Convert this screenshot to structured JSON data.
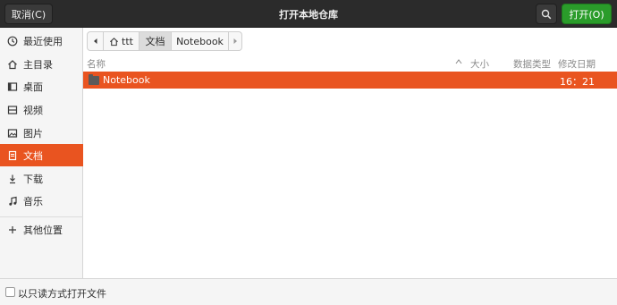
{
  "header": {
    "cancel_label": "取消(C)",
    "title": "打开本地仓库",
    "open_label": "打开(O)"
  },
  "sidebar": {
    "items": [
      {
        "label": "最近使用",
        "icon": "clock-icon"
      },
      {
        "label": "主目录",
        "icon": "home-icon"
      },
      {
        "label": "桌面",
        "icon": "desktop-icon"
      },
      {
        "label": "视频",
        "icon": "video-icon"
      },
      {
        "label": "图片",
        "icon": "picture-icon"
      },
      {
        "label": "文档",
        "icon": "document-icon",
        "active": true
      },
      {
        "label": "下载",
        "icon": "download-icon"
      },
      {
        "label": "音乐",
        "icon": "music-icon"
      },
      {
        "label": "其他位置",
        "icon": "plus-icon"
      }
    ]
  },
  "pathbar": {
    "segments": [
      "ttt",
      "文档",
      "Notebook"
    ],
    "current": "文档"
  },
  "columns": {
    "name": "名称",
    "size": "大小",
    "type": "数据类型",
    "modified": "修改日期"
  },
  "files": [
    {
      "name": "Notebook",
      "modified": "16：21"
    }
  ],
  "footer": {
    "readonly_label": "以只读方式打开文件"
  },
  "colors": {
    "accent": "#e95420",
    "open_button": "#2a9c2a",
    "header_bg": "#2b2b2b"
  }
}
